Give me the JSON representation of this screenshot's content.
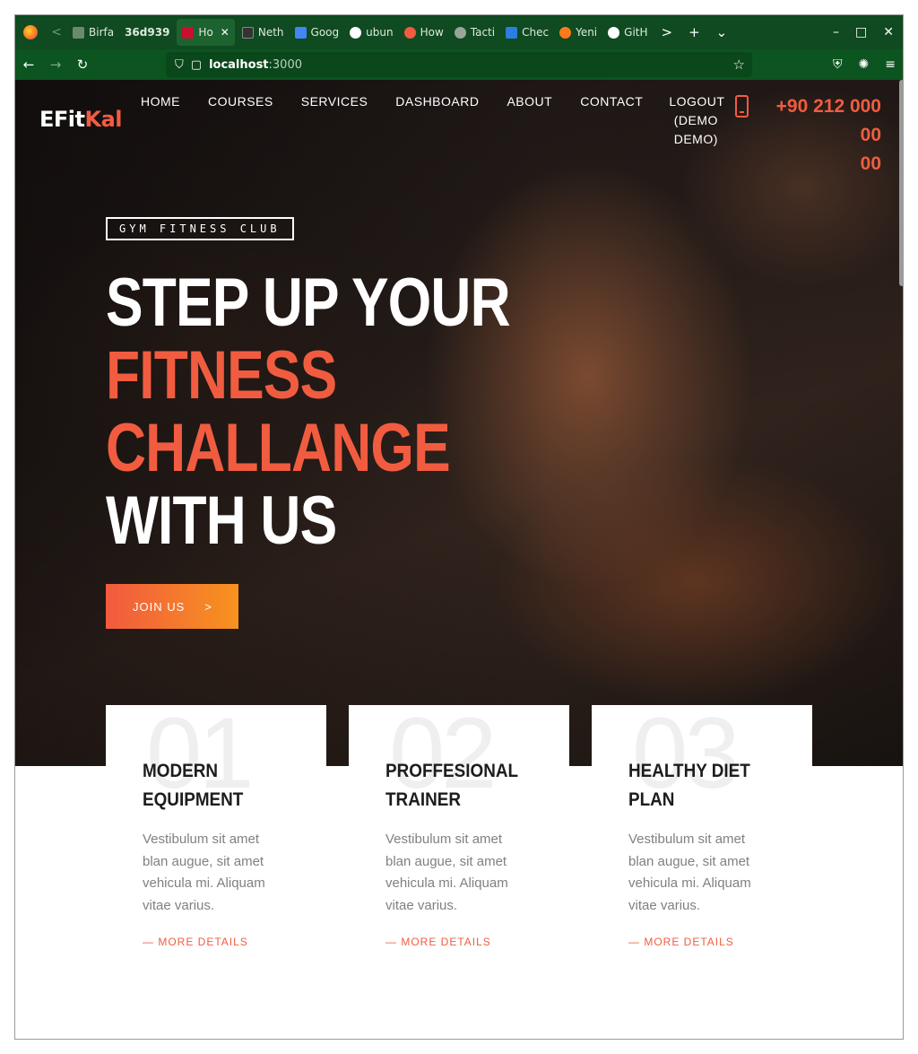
{
  "browser": {
    "tabs": [
      {
        "label": "Birfa",
        "color": "#6b8a6b"
      },
      {
        "label": "36d939",
        "color": "#0f4a20"
      },
      {
        "label": "Ho",
        "color": "#c8102e",
        "active": true
      },
      {
        "label": "Neth",
        "color": "#333333"
      },
      {
        "label": "Goog",
        "color": "#4285f4"
      },
      {
        "label": "ubun",
        "color": "#ffffff"
      },
      {
        "label": "How",
        "color": "#f15c40"
      },
      {
        "label": "Tacti",
        "color": "#9aa59a"
      },
      {
        "label": "Chec",
        "color": "#2a7de1"
      },
      {
        "label": "Yeni",
        "color": "#ff7a1a"
      },
      {
        "label": "GitH",
        "color": "#ffffff"
      }
    ],
    "url_host": "localhost",
    "url_port": ":3000",
    "controls": {
      "next": ">",
      "new_tab": "+",
      "list": "⌄",
      "minimize": "–",
      "maximize": "□",
      "close": "✕"
    }
  },
  "site": {
    "logo_main": "EFit",
    "logo_accent": "Kal",
    "menu": [
      "HOME",
      "COURSES",
      "SERVICES",
      "DASHBOARD",
      "ABOUT",
      "CONTACT"
    ],
    "logout": [
      "LOGOUT",
      "(DEMO",
      "DEMO)"
    ],
    "phone_line1": "+90 212 000 00",
    "phone_line2": "00",
    "accent_color": "#f15c40"
  },
  "hero": {
    "tag": "GYM FITNESS CLUB",
    "line1": "STEP UP YOUR",
    "line2": "FITNESS",
    "line3": "CHALLANGE",
    "line4": "WITH US",
    "button": "JOIN US"
  },
  "features": [
    {
      "number": "01",
      "title_1": "MODERN",
      "title_2": "EQUIPMENT",
      "desc": "Vestibulum sit amet blan augue, sit amet vehicula mi. Aliquam vitae varius.",
      "link": "MORE DETAILS"
    },
    {
      "number": "02",
      "title_1": "PROFFESIONAL",
      "title_2": "TRAINER",
      "desc": "Vestibulum sit amet blan augue, sit amet vehicula mi. Aliquam vitae varius.",
      "link": "MORE DETAILS"
    },
    {
      "number": "03",
      "title_1": "HEALTHY DIET",
      "title_2": "PLAN",
      "desc": "Vestibulum sit amet blan augue, sit amet vehicula mi. Aliquam vitae varius.",
      "link": "MORE DETAILS"
    }
  ]
}
